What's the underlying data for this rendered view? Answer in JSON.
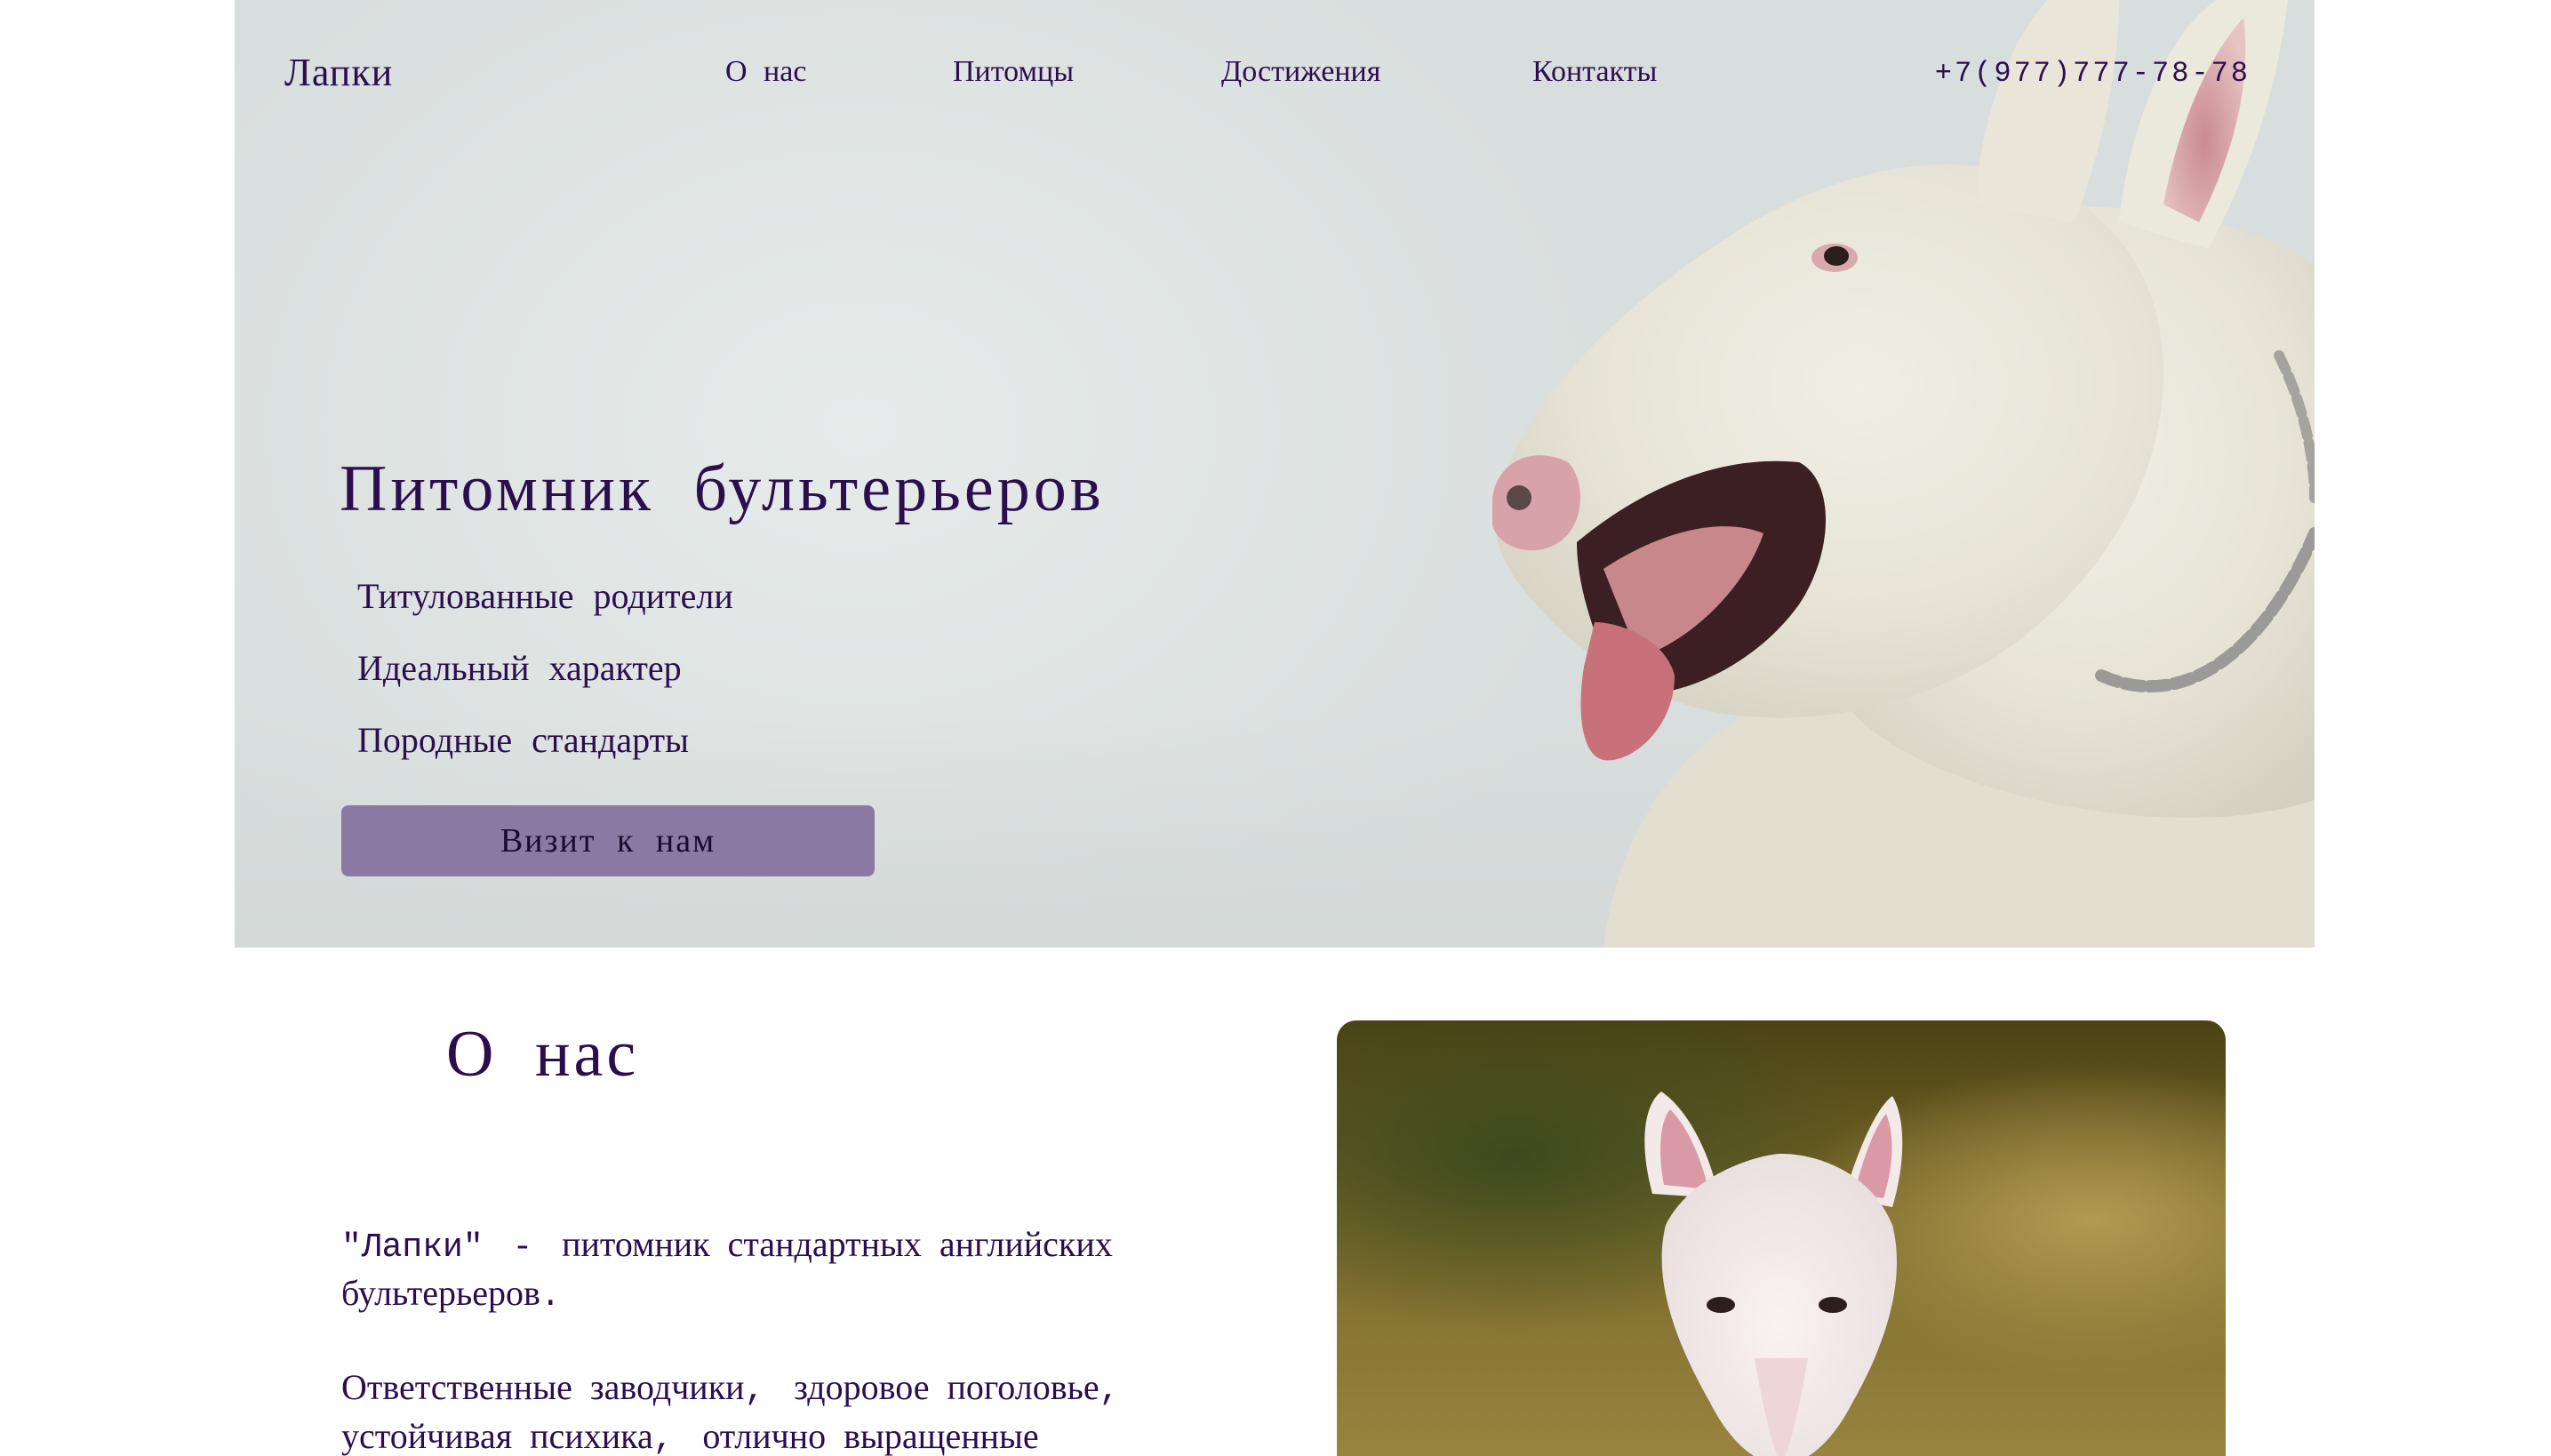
{
  "header": {
    "logo": "Лапки",
    "nav": [
      "О нас",
      "Питомцы",
      "Достижения",
      "Контакты"
    ],
    "phone": "+7(977)777-78-78"
  },
  "hero": {
    "title": "Питомник бультерьеров",
    "features": [
      "Титулованные родители",
      "Идеальный характер",
      "Породные стандарты"
    ],
    "button_label": "Визит к нам",
    "button_color": "#8a79a2",
    "photo": "dog-photo"
  },
  "about": {
    "title": "О нас",
    "paragraph_1": {
      "quote": "\"Лапки\"",
      "dash": " - ",
      "text": "питомник стандартных английских бультерьеров",
      "end": "."
    },
    "paragraph_2": {
      "part1": "Ответственные заводчики",
      "comma1": ", ",
      "part2": "здоровое поголовье",
      "comma2": ", ",
      "part3": "устойчивая психика",
      "comma3": ", ",
      "part4": "отлично выращенные"
    },
    "photo": "dog-photo"
  },
  "colors": {
    "text": "#2c0e4f",
    "accent": "#8a79a2",
    "hero_bg": "#dfe4e3"
  }
}
